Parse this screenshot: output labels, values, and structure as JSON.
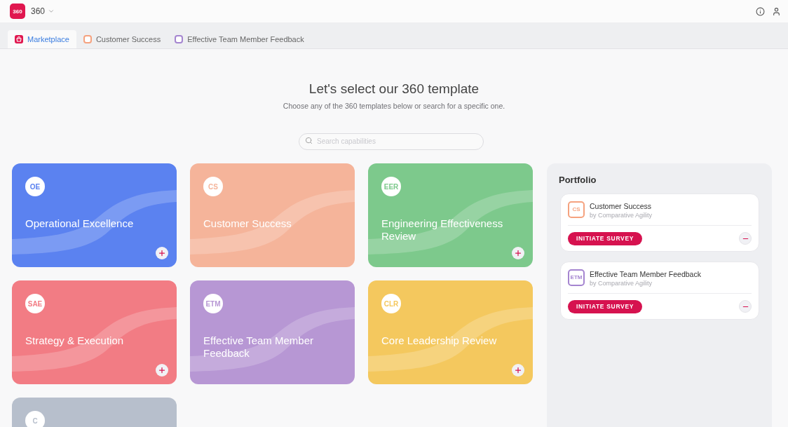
{
  "app": {
    "logo_text": "360",
    "title": "360"
  },
  "tabs": [
    {
      "label": "Marketplace",
      "selected": true,
      "kind": "home"
    },
    {
      "label": "Customer Success",
      "selected": false,
      "kind": "template",
      "color": "#f5a27f"
    },
    {
      "label": "Effective Team Member Feedback",
      "selected": false,
      "kind": "template",
      "color": "#a585d0"
    }
  ],
  "hero": {
    "title": "Let's select our 360 template",
    "subtitle": "Choose any of the 360 templates below or search for a specific one."
  },
  "search": {
    "placeholder": "Search capabilities"
  },
  "templates": [
    {
      "badge": "OE",
      "title": "Operational Excellence",
      "color": "#5b82f0",
      "addable": true
    },
    {
      "badge": "CS",
      "title": "Customer Success",
      "color": "#f5b49a",
      "addable": false
    },
    {
      "badge": "EER",
      "title": "Engineering Effectiveness Review",
      "color": "#7dc98c",
      "addable": true
    },
    {
      "badge": "SAE",
      "title": "Strategy & Execution",
      "color": "#f27c84",
      "addable": true
    },
    {
      "badge": "ETM",
      "title": "Effective Team Member Feedback",
      "color": "#b797d4",
      "addable": false
    },
    {
      "badge": "CLR",
      "title": "Core Leadership Review",
      "color": "#f4c85e",
      "addable": true
    },
    {
      "badge": "C",
      "color": "#b7bfcc"
    }
  ],
  "portfolio": {
    "title": "Portfolio",
    "items": [
      {
        "badge": "CS",
        "title": "Customer Success",
        "byline": "by Comparative Agility",
        "button": "INITIATE SURVEY",
        "color": "#f5a27f"
      },
      {
        "badge": "ETM",
        "title": "Effective Team Member Feedback",
        "byline": "by Comparative Agility",
        "button": "INITIATE SURVEY",
        "color": "#a585d0"
      }
    ]
  }
}
